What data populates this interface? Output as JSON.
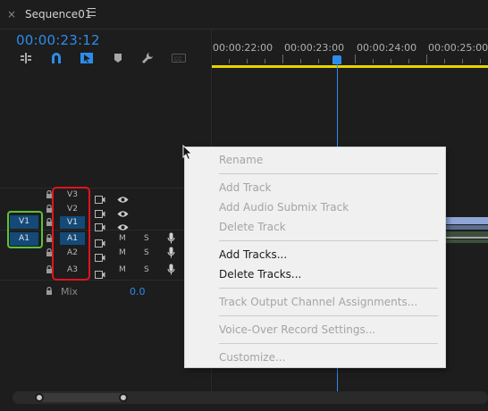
{
  "panel": {
    "close_glyph": "×",
    "title": "Sequence01"
  },
  "timecode": "00:00:23:12",
  "ruler": {
    "labels": [
      "00:00:22:00",
      "00:00:23:00",
      "00:00:24:00",
      "00:00:25:00"
    ]
  },
  "tools": [
    "ripple-insert-icon",
    "snap-magnet-icon",
    "linked-selection-icon",
    "marker-icon",
    "wrench-icon",
    "captions-icon"
  ],
  "tracks": {
    "video": [
      "V3",
      "V2",
      "V1"
    ],
    "audio": [
      "A1",
      "A2",
      "A3"
    ],
    "source_video": "V1",
    "source_audio": "A1",
    "mute_label": "M",
    "solo_label": "S"
  },
  "mix": {
    "label": "Mix",
    "value": "0.0"
  },
  "context_menu": {
    "rename": "Rename",
    "add_track": "Add Track",
    "add_audio_submix_track": "Add Audio Submix Track",
    "delete_track": "Delete Track",
    "add_tracks": "Add Tracks...",
    "delete_tracks": "Delete Tracks...",
    "track_output": "Track Output Channel Assignments...",
    "voice_over": "Voice-Over Record Settings...",
    "customize": "Customize..."
  },
  "colors": {
    "accent_blue": "#2d8ceb",
    "highlight_green": "#5bc13b",
    "highlight_red": "#e0141e",
    "work_area": "#e8d400"
  }
}
